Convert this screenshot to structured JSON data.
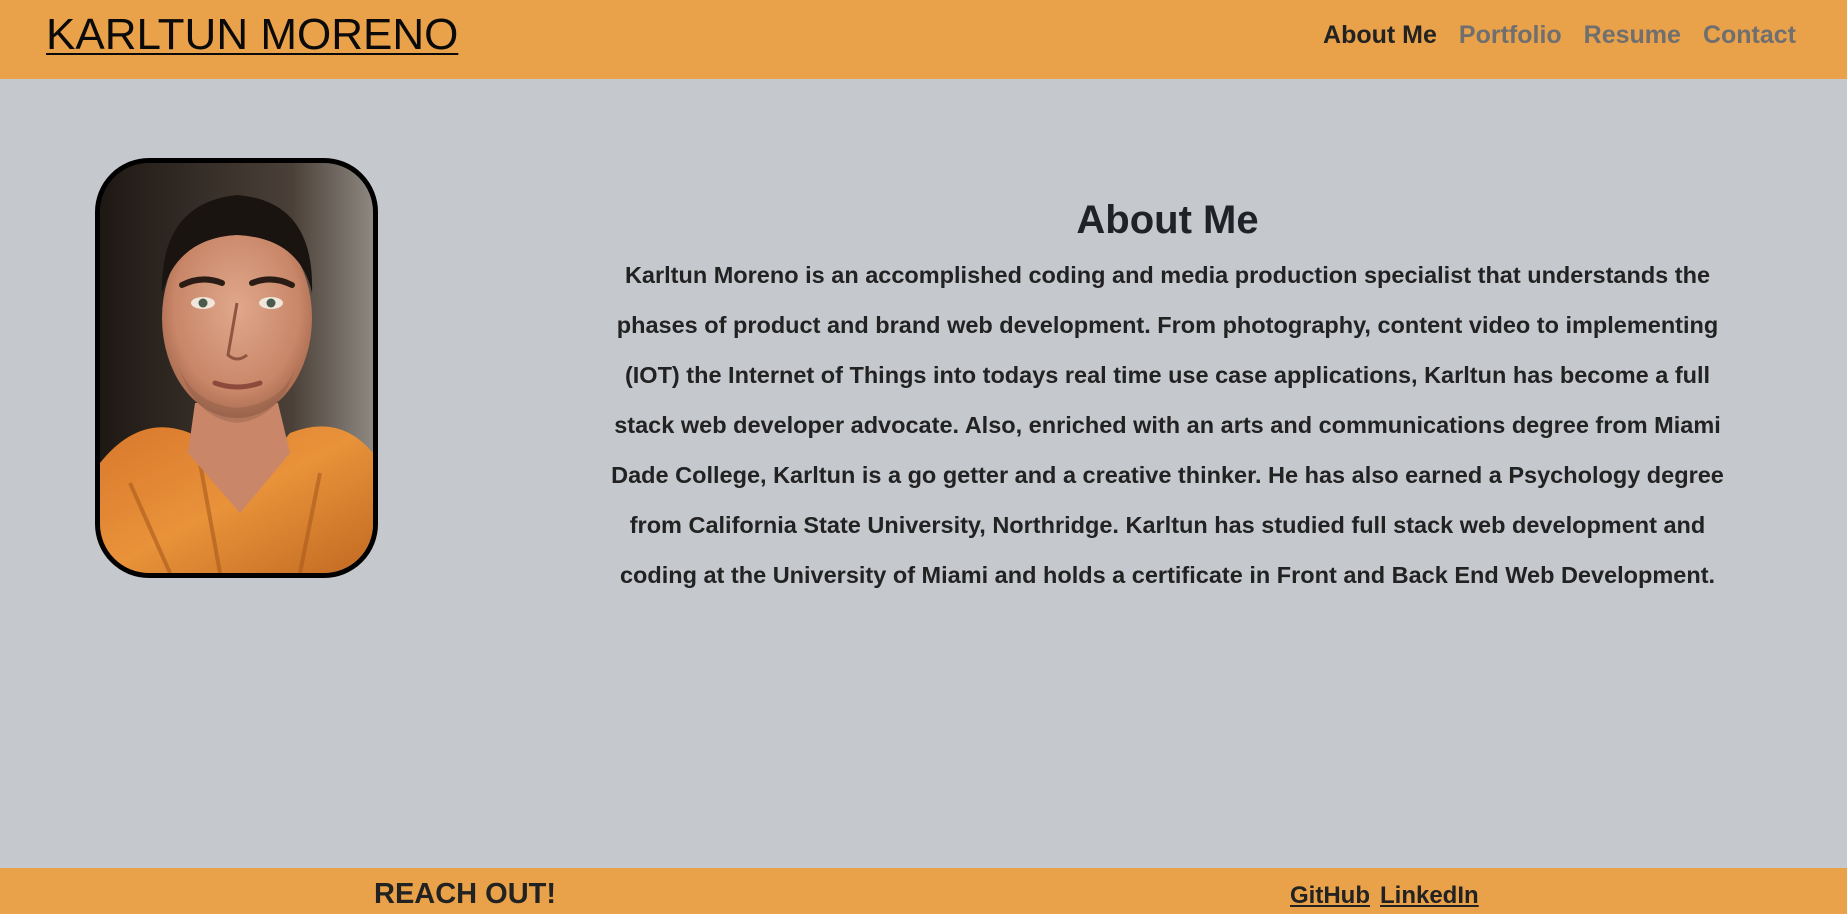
{
  "header": {
    "brand": "KARLTUN MORENO",
    "nav": [
      {
        "label": "About Me",
        "active": true
      },
      {
        "label": "Portfolio",
        "active": false
      },
      {
        "label": "Resume",
        "active": false
      },
      {
        "label": "Contact",
        "active": false
      }
    ]
  },
  "about": {
    "heading": "About Me",
    "body": "Karltun Moreno is an accomplished coding and media production specialist that understands the phases of product and brand web development. From photography, content video to implementing (IOT) the Internet of Things into todays real time use case applications, Karltun has become a full stack web developer advocate. Also, enriched with an arts and communications degree from Miami Dade College, Karltun is a go getter and a creative thinker. He has also earned a Psychology degree from California State University, Northridge. Karltun has studied full stack web development and coding at the University of Miami and holds a certificate in Front and Back End Web Development."
  },
  "footer": {
    "reach_out": "REACH OUT!",
    "links": [
      "GitHub",
      "LinkedIn"
    ]
  },
  "colors": {
    "accent": "#e9a24a",
    "background": "#c5c8cd",
    "text": "#212529",
    "nav_inactive": "#6f6f6f"
  }
}
